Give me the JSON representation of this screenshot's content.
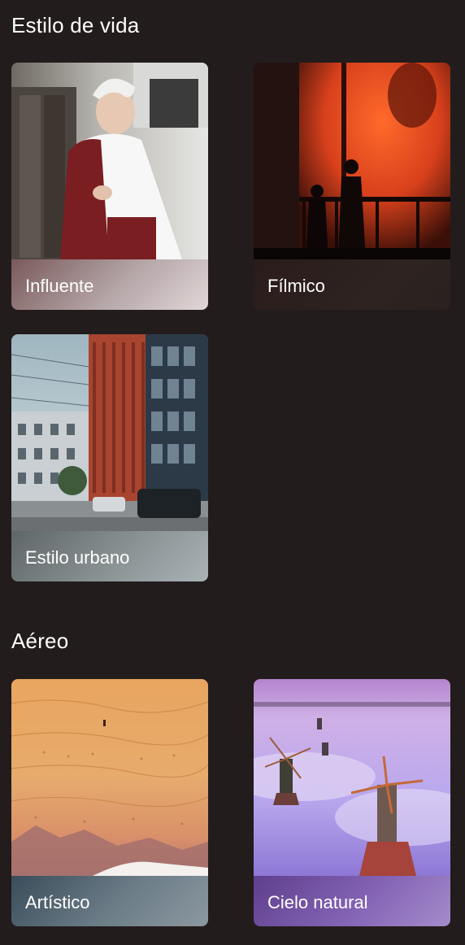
{
  "sections": [
    {
      "title": "Estilo de vida",
      "cards": [
        {
          "label": "Influente"
        },
        {
          "label": "Fílmico"
        },
        {
          "label": "Estilo urbano"
        }
      ]
    },
    {
      "title": "Aéreo",
      "cards": [
        {
          "label": "Artístico"
        },
        {
          "label": "Cielo natural"
        }
      ]
    }
  ],
  "colors": {
    "background": "#231c1c",
    "text": "#ffffff"
  }
}
